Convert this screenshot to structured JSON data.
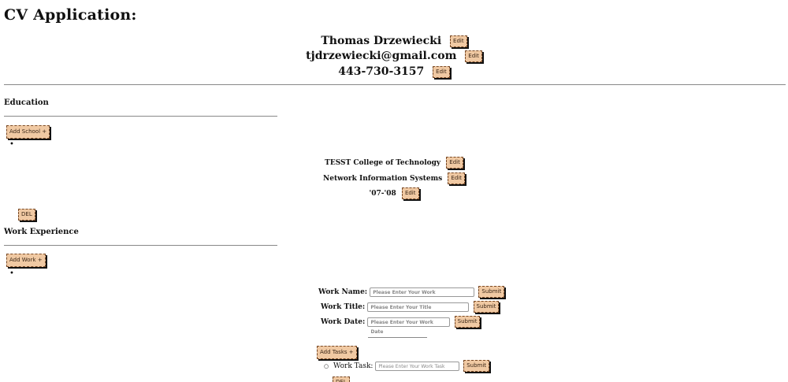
{
  "app": {
    "title": "CV Application:"
  },
  "header": {
    "name": "Thomas Drzewiecki",
    "email": "tjdrzewiecki@gmail.com",
    "phone": "443-730-3157",
    "edit_label": "Edit"
  },
  "education": {
    "heading": "Education",
    "add_button": "Add School +",
    "entries": [
      {
        "school": "TESST College of Technology",
        "program": "Network Information Systems",
        "dates": "'07-'08"
      }
    ],
    "edit_label": "Edit",
    "delete_label": "DEL"
  },
  "work": {
    "heading": "Work Experience",
    "add_button": "Add Work +",
    "form": {
      "name_label": "Work Name:",
      "name_placeholder": "Please Enter Your Work",
      "title_label": "Work Title:",
      "title_placeholder": "Please Enter Your Title",
      "date_label": "Work Date:",
      "date_placeholder": "Please Enter Your Work Date",
      "submit_label": "Submit",
      "add_tasks_label": "Add Tasks +",
      "task_label": "Work Task:",
      "task_placeholder": "Please Enter Your Work Task"
    }
  }
}
